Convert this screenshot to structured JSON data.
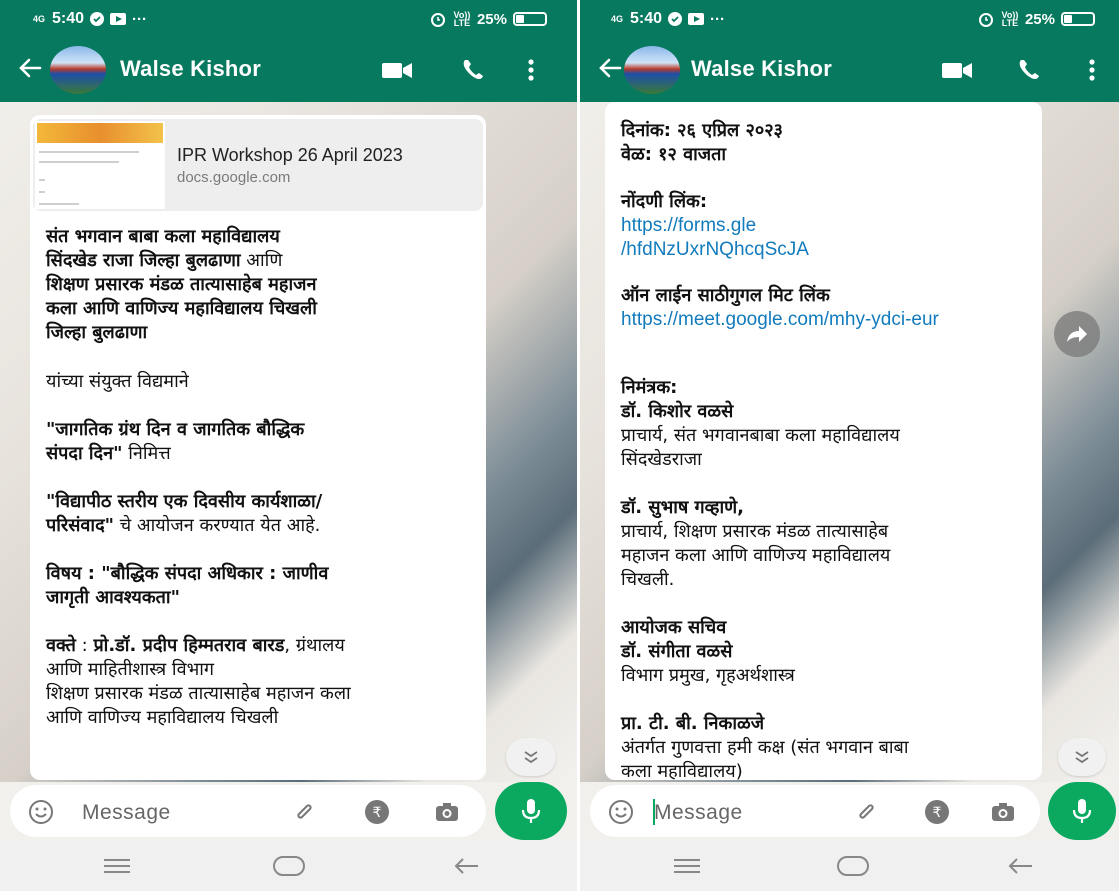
{
  "status": {
    "network": "4G",
    "time": "5:40",
    "more": "···",
    "volte": "Vo))\nLTE",
    "battery": "25%"
  },
  "contact": {
    "name": "Walse Kishor"
  },
  "left": {
    "preview": {
      "title": "IPR Workshop 26 April 2023",
      "url": "docs.google.com"
    },
    "lines": [
      {
        "bold": "संत भगवान बाबा कला महाविद्यालय",
        "normal": ""
      },
      {
        "bold": "सिंदखेड राजा जिल्हा बुलढाणा",
        "normal": " आणि"
      },
      {
        "bold": "शिक्षण प्रसारक मंडळ तात्यासाहेब महाजन",
        "normal": ""
      },
      {
        "bold": "कला आणि वाणिज्य महाविद्यालय चिखली",
        "normal": ""
      },
      {
        "bold": "जिल्हा बुलढाणा",
        "normal": ""
      },
      {
        "bold": "",
        "normal": "यांच्या संयुक्त विद्यमाने"
      },
      {
        "bold": "\"जागतिक ग्रंथ दिन व जागतिक बौद्धिक",
        "normal": ""
      },
      {
        "bold": "संपदा  दिन\"",
        "normal": " निमित्त"
      },
      {
        "bold": "\"विद्यापीठ स्तरीय एक दिवसीय कार्यशाळा/",
        "normal": ""
      },
      {
        "bold": "परिसंवाद\"",
        "normal": " चे आयोजन करण्यात येत आहे."
      },
      {
        "bold": "विषय : \"बौद्धिक संपदा अधिकार : जाणीव",
        "normal": ""
      },
      {
        "bold": "जागृती आवश्यकता\"",
        "normal": ""
      },
      {
        "bold": "वक्ते",
        "normal": " : "
      },
      {
        "bold": "",
        "normal": "आणि माहितीशास्त्र विभाग"
      },
      {
        "bold": "",
        "normal": "शिक्षण प्रसारक मंडळ तात्यासाहेब महाजन कला"
      },
      {
        "bold": "",
        "normal": "आणि वाणिज्य महाविद्यालय चिखली"
      }
    ],
    "speaker_name": "प्रो.डॉ. प्रदीप हिम्मतराव बारड",
    "speaker_dept": ", ग्रंथालय"
  },
  "right": {
    "lines": [
      {
        "bold": "दिनांक: २६ एप्रिल २०२३",
        "normal": "",
        "link": ""
      },
      {
        "bold": "वेळ: १२ वाजता",
        "normal": "",
        "link": ""
      },
      {
        "bold": "नोंदणी लिंक:",
        "normal": "",
        "link": ""
      },
      {
        "bold": "",
        "normal": "",
        "link": "https://forms.gle"
      },
      {
        "bold": "",
        "normal": "",
        "link": "/hfdNzUxrNQhcqScJA"
      },
      {
        "bold": "ऑन लाईन साठीगुगल मिट लिंक",
        "normal": "",
        "link": ""
      },
      {
        "bold": "",
        "normal": "",
        "link": "https://meet.google.com/mhy-ydci-eur"
      },
      {
        "bold": "निमंत्रक:",
        "normal": "",
        "link": ""
      },
      {
        "bold": "डॉ. किशोर वळसे",
        "normal": "",
        "link": ""
      },
      {
        "bold": "",
        "normal": "प्राचार्य, संत भगवानबाबा कला महाविद्यालय",
        "link": ""
      },
      {
        "bold": "",
        "normal": "सिंदखेडराजा",
        "link": ""
      },
      {
        "bold": "डॉ. सुभाष गव्हाणे,",
        "normal": "",
        "link": ""
      },
      {
        "bold": "",
        "normal": "प्राचार्य, शिक्षण प्रसारक मंडळ तात्यासाहेब",
        "link": ""
      },
      {
        "bold": "",
        "normal": "महाजन कला आणि वाणिज्य महाविद्यालय",
        "link": ""
      },
      {
        "bold": "",
        "normal": "चिखली.",
        "link": ""
      },
      {
        "bold": "आयोजक सचिव",
        "normal": "",
        "link": ""
      },
      {
        "bold": "डॉ. संगीता वळसे",
        "normal": "",
        "link": ""
      },
      {
        "bold": "",
        "normal": "विभाग प्रमुख, गृहअर्थशास्त्र",
        "link": ""
      },
      {
        "bold": "प्रा. टी. बी. निकाळजे",
        "normal": "",
        "link": ""
      },
      {
        "bold": "",
        "normal": "अंतर्गत गुणवत्ता हमी कक्ष (संत भगवान बाबा",
        "link": ""
      },
      {
        "bold": "",
        "normal": "कला महाविद्यालय)",
        "link": ""
      }
    ]
  },
  "input": {
    "placeholder": "Message"
  },
  "colors": {
    "header": "#06795f",
    "mic": "#0aa95f",
    "link": "#127bbd"
  }
}
